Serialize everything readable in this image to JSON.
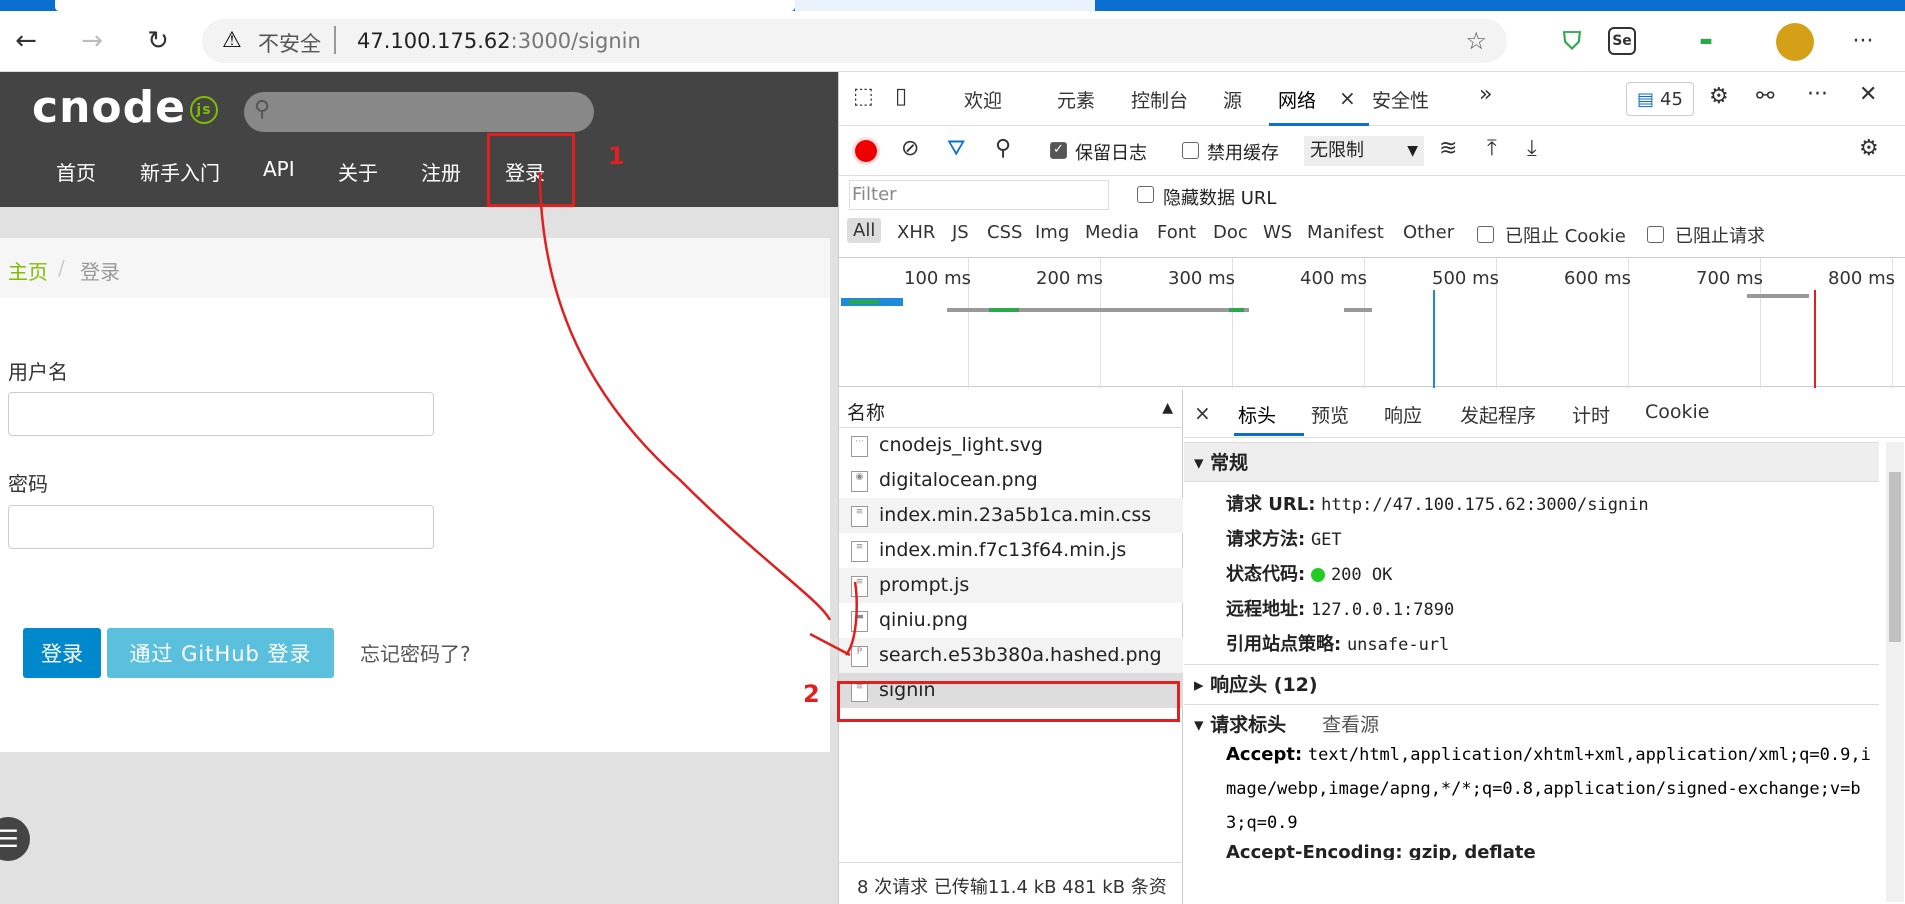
{
  "browser": {
    "nav": {
      "back_icon": "←",
      "forward_icon": "→",
      "reload_icon": "↻"
    },
    "address": {
      "warn_icon": "⚠",
      "security_label": "不安全",
      "url_host": "47.100.175.62",
      "url_rest": ":3000/signin"
    },
    "extensions": [
      "Se"
    ],
    "menu_icon": "···"
  },
  "page": {
    "logo_text": "cnode",
    "logo_suffix": "js",
    "nav_items": [
      "首页",
      "新手入门",
      "API",
      "关于",
      "注册",
      "登录"
    ],
    "breadcrumb": {
      "home": "主页",
      "separator": "/",
      "current": "登录"
    },
    "form": {
      "username_label": "用户名",
      "password_label": "密码",
      "login_button": "登录",
      "github_button": "通过 GitHub 登录",
      "forgot_link": "忘记密码了?"
    }
  },
  "devtools": {
    "tabs": [
      "欢迎",
      "元素",
      "控制台",
      "源",
      "网络",
      "安全性"
    ],
    "active_tab": "网络",
    "more_tabs_icon": "»",
    "issues_count": "45",
    "toolbar": {
      "preserve_log": "保留日志",
      "disable_cache": "禁用缓存",
      "throttling": "无限制"
    },
    "filter": {
      "placeholder": "Filter",
      "hide_data_urls": "隐藏数据 URL"
    },
    "types": [
      "All",
      "XHR",
      "JS",
      "CSS",
      "Img",
      "Media",
      "Font",
      "Doc",
      "WS",
      "Manifest",
      "Other"
    ],
    "blocked_cookies": "已阻止 Cookie",
    "blocked_requests": "已阻止请求",
    "timeline_ticks": [
      "100 ms",
      "200 ms",
      "300 ms",
      "400 ms",
      "500 ms",
      "600 ms",
      "700 ms",
      "800 ms"
    ],
    "request_list": {
      "header": "名称",
      "items": [
        "cnodejs_light.svg",
        "digitalocean.png",
        "index.min.23a5b1ca.min.css",
        "index.min.f7c13f64.min.js",
        "prompt.js",
        "qiniu.png",
        "search.e53b380a.hashed.png",
        "signin"
      ],
      "selected": "signin",
      "status": "8 次请求  已传输11.4 kB  481 kB 条资"
    },
    "details": {
      "close_icon": "×",
      "tabs": [
        "标头",
        "预览",
        "响应",
        "发起程序",
        "计时",
        "Cookie"
      ],
      "general_title": "常规",
      "general": [
        {
          "key": "请求 URL:",
          "value": "http://47.100.175.62:3000/signin"
        },
        {
          "key": "请求方法:",
          "value": "GET"
        },
        {
          "key": "状态代码:",
          "value": "200 OK"
        },
        {
          "key": "远程地址:",
          "value": "127.0.0.1:7890"
        },
        {
          "key": "引用站点策略:",
          "value": "unsafe-url"
        }
      ],
      "response_headers": "响应头 (12)",
      "request_headers": "请求标头",
      "view_source": "查看源",
      "accept_key": "Accept:",
      "accept_value": "text/html,application/xhtml+xml,application/xml;q=0.9,image/webp,image/apng,*/*;q=0.8,application/signed-exchange;v=b3;q=0.9",
      "accept_encoding_partial": "Accept-Encoding: gzip, deflate"
    }
  },
  "annotations": {
    "step1": "1",
    "step2": "2"
  },
  "colors": {
    "accent": "#0a6fd0",
    "brand_green": "#80bd01",
    "annotation_red": "#e02020"
  }
}
